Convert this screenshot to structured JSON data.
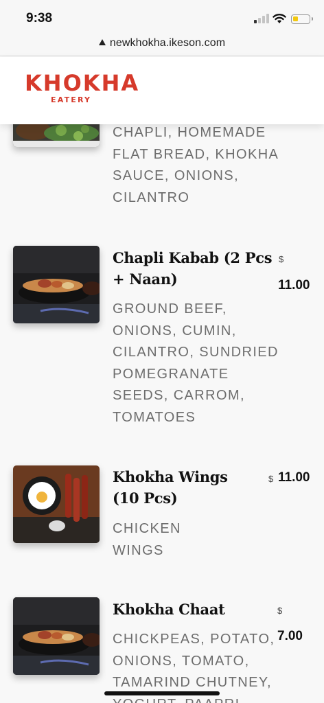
{
  "status_bar": {
    "time": "9:38",
    "signal_bars_on": 1,
    "battery_level": 0.3,
    "battery_color": "#f2c80f"
  },
  "browser": {
    "url": "newkhokha.ikeson.com"
  },
  "brand": {
    "logo_text": "KHOKHA",
    "logo_sub": "EATERY",
    "color": "#d63a2b"
  },
  "menu": {
    "partial_item": {
      "description": [
        "CHAPLI, HOMEMADE",
        "FLAT BREAD, KHOKHA",
        "SAUCE, ONIONS,",
        "CILANTRO"
      ]
    },
    "items": [
      {
        "name_lines": [
          "Chapli Kabab (2 Pcs",
          "+ Naan)"
        ],
        "currency": "$",
        "price": "11.00",
        "description": [
          "GROUND BEEF,",
          "ONIONS, CUMIN,",
          "CILANTRO, SUNDRIED",
          "POMEGRANATE",
          "SEEDS, CARROM,",
          "TOMATOES"
        ]
      },
      {
        "name_lines": [
          "Khokha Wings",
          "(10 Pcs)"
        ],
        "currency": "$",
        "price": "11.00",
        "description": [
          "CHICKEN",
          "WINGS"
        ]
      },
      {
        "name_lines": [
          "Khokha Chaat"
        ],
        "currency": "$",
        "price": "7.00",
        "description": [
          "CHICKPEAS, POTATO,",
          "ONIONS, TOMATO,",
          "TAMARIND CHUTNEY,",
          "YOGURT, PAAPRI"
        ]
      }
    ]
  }
}
